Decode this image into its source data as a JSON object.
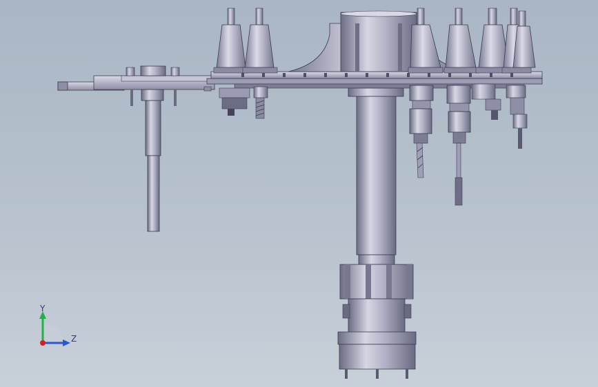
{
  "triad": {
    "y_label": "Y",
    "z_label": "Z"
  },
  "colors": {
    "background_top": "#aab6c4",
    "background_bottom": "#c8d0d9",
    "part_light": "#c7c7d8",
    "part_mid": "#9d9db3",
    "part_dark": "#5a5a70",
    "axis_y": "#22b04a",
    "axis_z": "#2a56d6",
    "axis_origin": "#d62020"
  },
  "icons": {
    "triad": "coordinate-triad-icon"
  }
}
